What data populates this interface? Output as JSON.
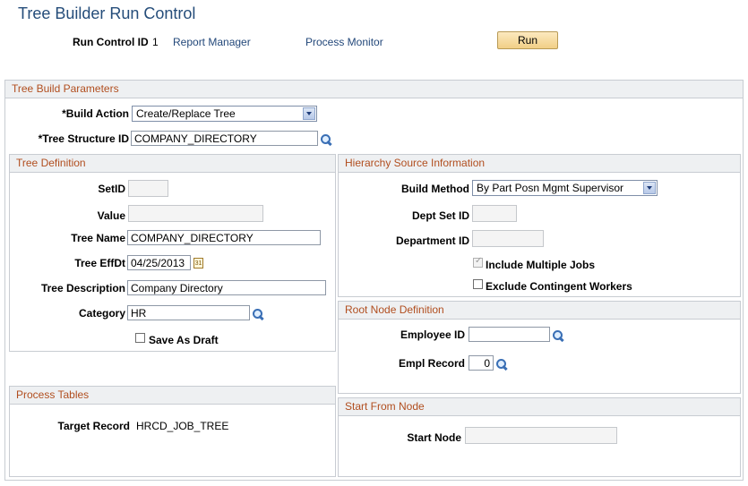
{
  "page": {
    "title": "Tree Builder Run Control",
    "run_control_label": "Run Control ID",
    "run_control_value": "1",
    "report_manager": "Report Manager",
    "process_monitor": "Process Monitor",
    "run_button": "Run"
  },
  "params": {
    "heading": "Tree Build Parameters",
    "build_action_label": "*Build Action",
    "build_action_value": "Create/Replace Tree",
    "tree_structure_label": "*Tree Structure ID",
    "tree_structure_value": "COMPANY_DIRECTORY"
  },
  "tree_def": {
    "heading": "Tree Definition",
    "setid_label": "SetID",
    "setid_value": "",
    "value_label": "Value",
    "value_value": "",
    "tree_name_label": "Tree Name",
    "tree_name_value": "COMPANY_DIRECTORY",
    "effdt_label": "Tree EffDt",
    "effdt_value": "04/25/2013",
    "desc_label": "Tree Description",
    "desc_value": "Company Directory",
    "category_label": "Category",
    "category_value": "HR",
    "save_draft_label": "Save As Draft",
    "save_draft_checked": false
  },
  "hierarchy": {
    "heading": "Hierarchy Source Information",
    "build_method_label": "Build Method",
    "build_method_value": "By Part Posn Mgmt Supervisor",
    "dept_setid_label": "Dept Set ID",
    "dept_setid_value": "",
    "department_label": "Department ID",
    "department_value": "",
    "include_multiple_label": "Include Multiple Jobs",
    "include_multiple_checked": true,
    "exclude_contingent_label": "Exclude Contingent Workers",
    "exclude_contingent_checked": false
  },
  "root_node": {
    "heading": "Root Node Definition",
    "employee_label": "Employee ID",
    "employee_value": "",
    "empl_record_label": "Empl Record",
    "empl_record_value": "0"
  },
  "process_tables": {
    "heading": "Process Tables",
    "target_label": "Target Record",
    "target_value": "HRCD_JOB_TREE"
  },
  "start_node": {
    "heading": "Start From Node",
    "start_label": "Start Node",
    "start_value": ""
  }
}
